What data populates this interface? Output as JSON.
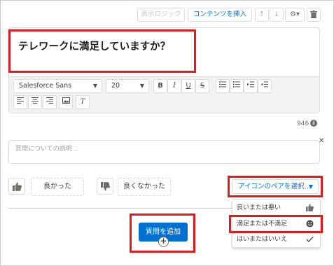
{
  "toolbar": {
    "display_logic": "表示ロジック",
    "insert_content": "コンテンツを挿入",
    "up_icon": "↑",
    "down_icon": "↓",
    "gear_icon": "⚙▾",
    "trash_icon": "🗑"
  },
  "question": {
    "text": "テレワークに満足していますか？"
  },
  "editor": {
    "font_value": "Salesforce Sans",
    "size_value": "20",
    "bold": "B",
    "italic": "I",
    "underline": "U",
    "strike": "S",
    "clear_format": "T"
  },
  "char_count": "946",
  "description": {
    "placeholder": "質問についての説明..."
  },
  "answers": {
    "positive": "良かった",
    "negative": "良くなかった"
  },
  "icon_pair": {
    "label": "アイコンのペアを選択..."
  },
  "dropdown": {
    "items": [
      {
        "label": "良いまたは悪い",
        "icon": "thumbs-up-icon"
      },
      {
        "label": "満足または不満足",
        "icon": "smiley-icon"
      },
      {
        "label": "はいまたはいいえ",
        "icon": "checkmark-icon"
      }
    ]
  },
  "add_question": {
    "label": "質問を追加",
    "plus": "+"
  },
  "colors": {
    "accent": "#0070d2",
    "highlight": "#e01b1b"
  }
}
